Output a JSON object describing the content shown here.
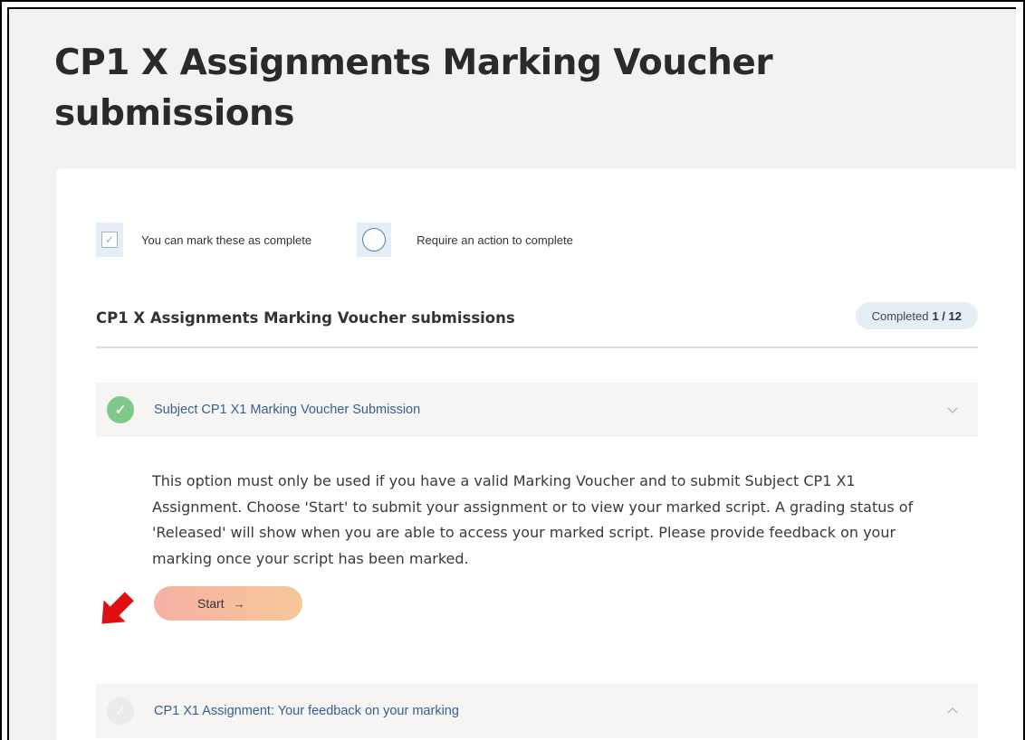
{
  "page": {
    "title": "CP1 X Assignments Marking Voucher submissions"
  },
  "legend": {
    "markable_label": "You can mark these as complete",
    "action_label": "Require an action to complete"
  },
  "section": {
    "title": "CP1 X Assignments Marking Voucher submissions",
    "completed_label": "Completed",
    "completed_count": "1 / 12"
  },
  "items": [
    {
      "label": "Subject CP1 X1 Marking Voucher Submission",
      "status": "complete",
      "expanded": true,
      "description": "This option must only be used if you have a valid Marking Voucher and to submit Subject CP1 X1 Assignment.  Choose 'Start' to submit your assignment or to view your marked script.  A grading status of 'Released' will show when you are able to access your marked script.  Please provide feedback on your marking once your script has been marked.",
      "button_label": "Start",
      "button_icon": "arrow-right-icon"
    },
    {
      "label": "CP1 X1 Assignment: Your feedback on your marking",
      "status": "incomplete",
      "expanded": false
    }
  ],
  "colors": {
    "complete_green": "#7cc98a",
    "link_blue": "#36618f",
    "annotation_red": "#e01010",
    "button_gradient_start": "#f6b1a4",
    "button_gradient_end": "#f6c79a"
  },
  "icons": {
    "annotation": "red-arrow-icon",
    "markable": "checkbox-icon",
    "action": "circle-icon"
  }
}
